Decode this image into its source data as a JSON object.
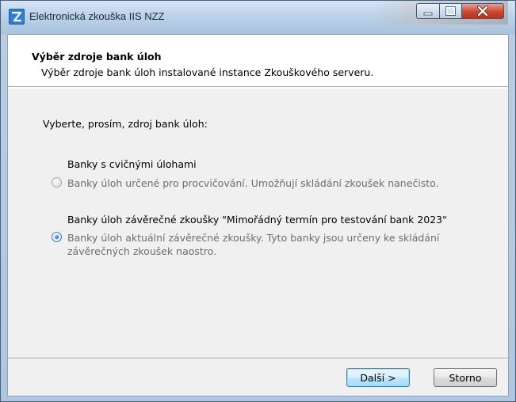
{
  "window": {
    "title": "Elektronická zkouška IIS NZZ"
  },
  "header": {
    "title": "Výběr zdroje bank úloh",
    "subtitle": "Výběr zdroje bank úloh instalované instance Zkouškového serveru."
  },
  "body": {
    "prompt": "Vyberte, prosím, zdroj bank úloh:",
    "options": [
      {
        "label": "Banky s cvičnými úlohami",
        "description": "Banky úloh určené pro procvičování. Umožňují skládání zkoušek nanečisto.",
        "selected": false
      },
      {
        "label": "Banky úloh závěrečné zkoušky \"Mimořádný termín pro testování bank 2023\"",
        "description": "Banky úloh aktuální závěrečné zkoušky. Tyto banky jsou určeny ke skládání závěrečných zkoušek naostro.",
        "selected": true
      }
    ]
  },
  "footer": {
    "next_label": "Další >",
    "cancel_label": "Storno"
  },
  "colors": {
    "accent": "#2d7fd0",
    "close_button": "#c74a33"
  }
}
